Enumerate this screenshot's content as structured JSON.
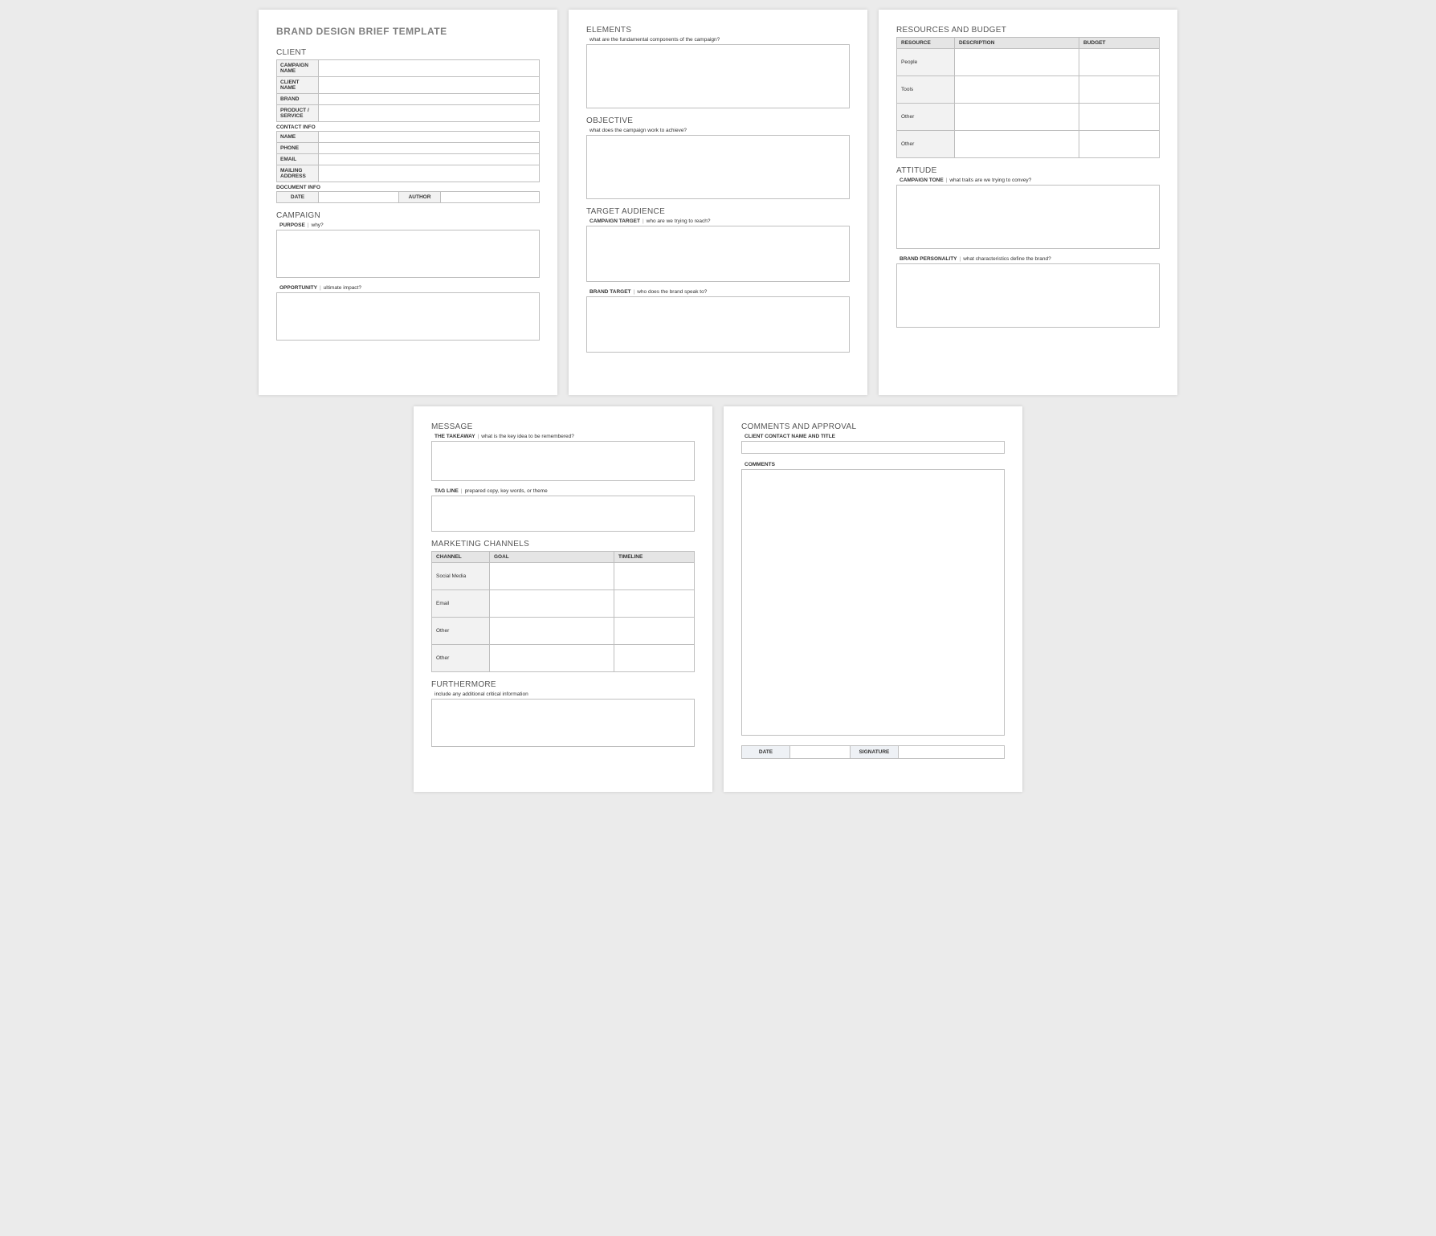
{
  "doc": {
    "title": "BRAND DESIGN BRIEF TEMPLATE"
  },
  "page1": {
    "client_h": "CLIENT",
    "rows": {
      "campaign_name": "CAMPAIGN NAME",
      "client_name": "CLIENT NAME",
      "brand": "BRAND",
      "product_service": "PRODUCT / SERVICE"
    },
    "contact_info_h": "CONTACT INFO",
    "contact": {
      "name": "NAME",
      "phone": "PHONE",
      "email": "EMAIL",
      "mailing": "MAILING ADDRESS"
    },
    "doc_info_h": "DOCUMENT INFO",
    "doc_info": {
      "date": "DATE",
      "author": "AUTHOR"
    },
    "campaign_h": "CAMPAIGN",
    "purpose_l": "PURPOSE",
    "purpose_q": "why?",
    "opportunity_l": "OPPORTUNITY",
    "opportunity_q": "ultimate impact?"
  },
  "page2": {
    "elements_h": "ELEMENTS",
    "elements_q": "what are the fundamental components of the campaign?",
    "objective_h": "OBJECTIVE",
    "objective_q": "what does the campaign work to achieve?",
    "ta_h": "TARGET AUDIENCE",
    "ct_l": "CAMPAIGN TARGET",
    "ct_q": "who are we trying to reach?",
    "bt_l": "BRAND TARGET",
    "bt_q": "who does the brand speak to?"
  },
  "page3": {
    "rb_h": "RESOURCES AND BUDGET",
    "cols": {
      "resource": "RESOURCE",
      "description": "DESCRIPTION",
      "budget": "BUDGET"
    },
    "rows": [
      "People",
      "Tools",
      "Other",
      "Other"
    ],
    "att_h": "ATTITUDE",
    "tone_l": "CAMPAIGN TONE",
    "tone_q": "what traits are we trying to convey?",
    "bp_l": "BRAND PERSONALITY",
    "bp_q": "what characteristics define the brand?"
  },
  "page4": {
    "msg_h": "MESSAGE",
    "tk_l": "THE TAKEAWAY",
    "tk_q": "what is the key idea to be remembered?",
    "tl_l": "TAG LINE",
    "tl_q": "prepared copy, key words, or theme",
    "mc_h": "MARKETING CHANNELS",
    "cols": {
      "channel": "CHANNEL",
      "goal": "GOAL",
      "timeline": "TIMELINE"
    },
    "rows": [
      "Social Media",
      "Email",
      "Other",
      "Other"
    ],
    "fm_h": "FURTHERMORE",
    "fm_q": "include any additional critical information"
  },
  "page5": {
    "ca_h": "COMMENTS AND APPROVAL",
    "ccnt": "CLIENT CONTACT NAME AND TITLE",
    "comments_l": "COMMENTS",
    "date_l": "DATE",
    "sig_l": "SIGNATURE"
  }
}
